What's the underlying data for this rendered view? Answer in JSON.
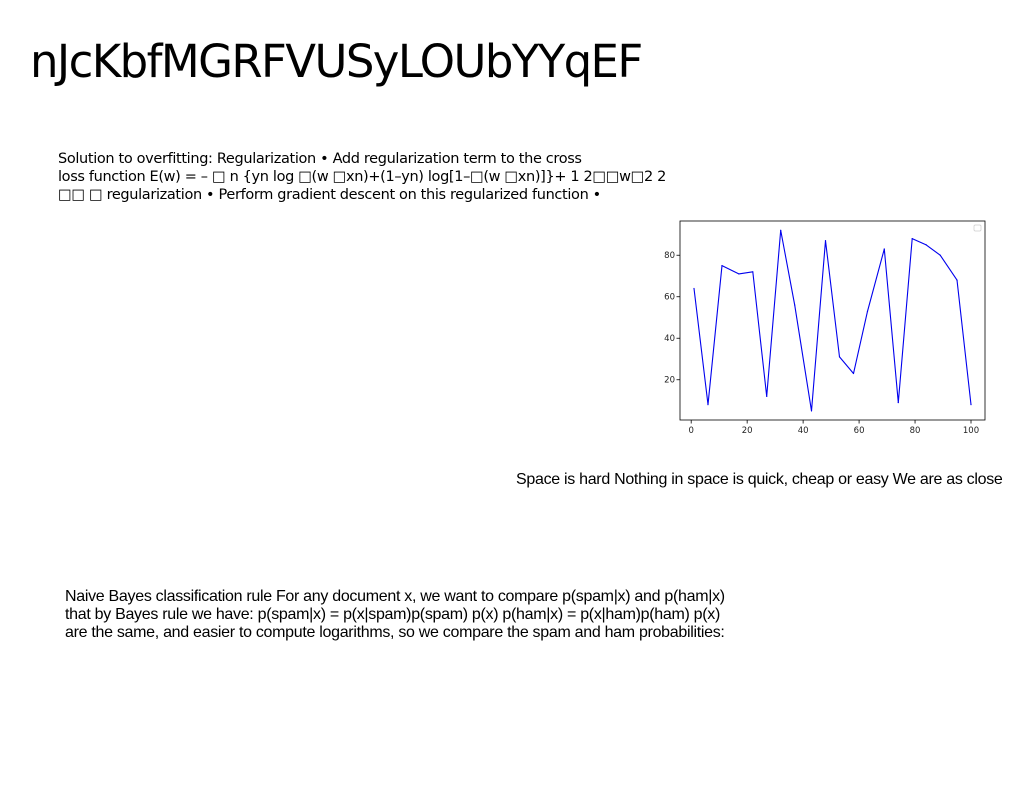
{
  "slide": {
    "title": "nJcKbfMGRFVUSyLOUbYYqEF",
    "overfitting_text": [
      "Solution to overfitting: Regularization • Add regularization term to the cross",
      "loss function E(w) = – □ n {yn log □(w □xn)+(1–yn) log[1–□(w □xn)]}+ 1 2□□w□2 2",
      "□□ □ regularization • Perform gradient descent on this regularized function •"
    ],
    "space_text": "Space is hard Nothing in space is quick, cheap or easy We are as close",
    "bayes_text": [
      "Naive Bayes classification rule For any document x, we want to compare p(spam|x) and p(ham|x)",
      "that by Bayes rule we have: p(spam|x) = p(x|spam)p(spam) p(x) p(ham|x) = p(x|ham)p(ham) p(x)",
      "are the same, and easier to compute logarithms, so we compare the spam and ham probabilities:"
    ]
  },
  "chart_data": {
    "type": "line",
    "x": [
      1,
      6,
      11,
      17,
      22,
      27,
      32,
      37,
      43,
      48,
      53,
      58,
      63,
      69,
      74,
      79,
      84,
      89,
      95,
      100
    ],
    "series": [
      {
        "values": [
          64,
          8,
          75,
          71,
          72,
          12,
          92,
          56,
          5,
          87,
          31,
          23,
          53,
          83,
          9,
          88,
          85,
          80,
          68,
          8
        ]
      }
    ],
    "xticks": [
      0,
      20,
      40,
      60,
      80,
      100
    ],
    "yticks": [
      20,
      40,
      60,
      80
    ],
    "xlim": [
      -4,
      105
    ],
    "ylim": [
      0.6,
      96.5
    ],
    "line_color": "#0000ee",
    "legend": "top-right",
    "grid": false
  }
}
